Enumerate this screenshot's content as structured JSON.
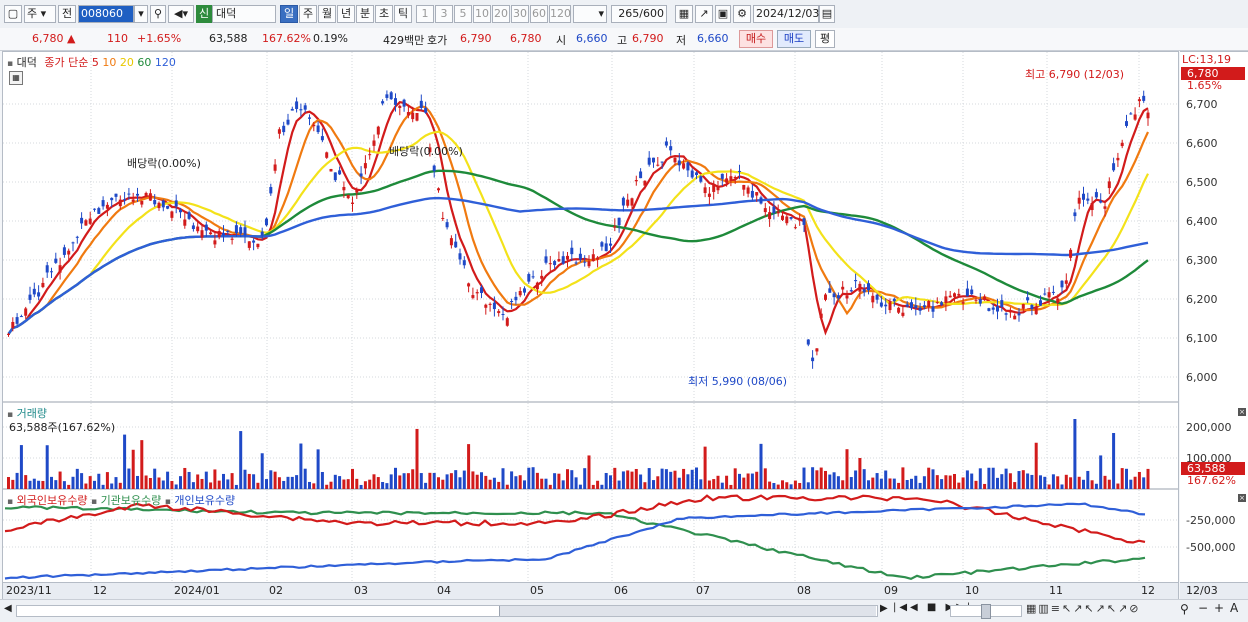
{
  "toolbar": {
    "type_select": "주",
    "market_btn": "전",
    "code": "008060",
    "badge_new": "신",
    "name": "대덕",
    "periods": [
      "일",
      "주",
      "월",
      "년",
      "분",
      "초",
      "틱"
    ],
    "numbers": [
      "1",
      "3",
      "5",
      "10",
      "20",
      "30",
      "60",
      "120"
    ],
    "count": "265",
    "count_total": "/600",
    "date": "2024/12/03"
  },
  "quote": {
    "price": "6,780 ▲",
    "change": "110",
    "change_pct": "+1.65%",
    "volume": "63,588",
    "vol_ratio": "167.62%",
    "turnover": "0.19%",
    "amount": "429백만",
    "hoga_label": "호가",
    "hoga_ask": "6,790",
    "hoga_bid": "6,780",
    "open_label": "시",
    "open": "6,660",
    "high_label": "고",
    "high": "6,790",
    "low_label": "저",
    "low": "6,660",
    "buy": "매수",
    "sell": "매도",
    "eval": "평"
  },
  "legend": {
    "name": "대덕",
    "ma_title": "종가 단순",
    "ma": [
      "5",
      "10",
      "20",
      "60",
      "120"
    ],
    "ma_colors": [
      "#d21b1b",
      "#f07a10",
      "#f3e21a",
      "#1e8a3a",
      "#2f5fd8"
    ]
  },
  "price_panel": {
    "lc": "LC:13,19",
    "last_tag": "6,780",
    "pct_tag": "1.65%",
    "y_ticks": [
      "6,700",
      "6,600",
      "6,500",
      "6,400",
      "6,300",
      "6,200",
      "6,100",
      "6,000"
    ],
    "high_note": "최고 6,790 (12/03)",
    "low_note": "최저 5,990 (08/06)",
    "div1": "배당락(0.00%)",
    "div2": "배당락(0.00%)"
  },
  "volume_panel": {
    "title": "거래량",
    "value": "63,588주(167.62%)",
    "y_ticks": [
      "200,000",
      "100,000"
    ],
    "last_tag": "63,588",
    "pct_tag": "167.62%"
  },
  "holdings_panel": {
    "legend": [
      "외국인보유수량",
      "기관보유수량",
      "개인보유수량"
    ],
    "y_ticks": [
      "-250,000",
      "-500,000"
    ]
  },
  "x_axis": [
    "2023/11",
    "12",
    "2024/01",
    "02",
    "03",
    "04",
    "05",
    "06",
    "07",
    "08",
    "09",
    "10",
    "11",
    "12"
  ],
  "x_right": "12/03",
  "colors": {
    "up": "#d21b1b",
    "down": "#1f49c7",
    "accent": "#3a6fc1"
  }
}
